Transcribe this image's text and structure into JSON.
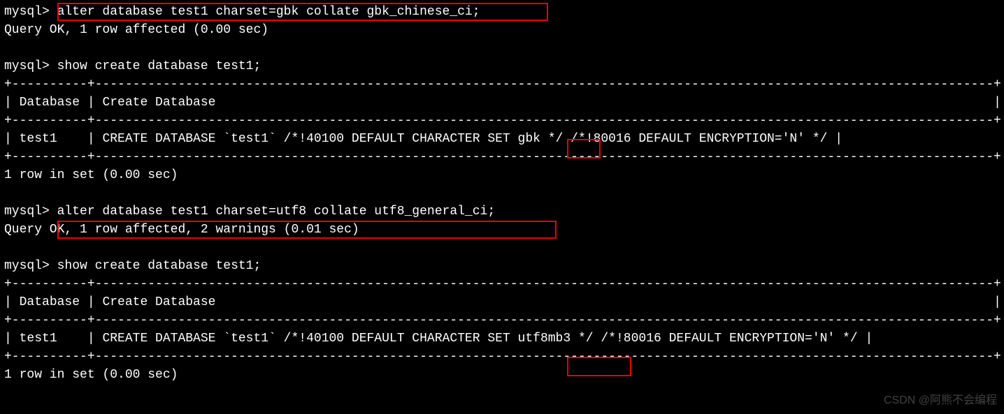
{
  "prompt": "mysql>",
  "cmd1": "alter database test1 charset=gbk collate gbk_chinese_ci;",
  "resp1": "Query OK, 1 row affected (0.00 sec)",
  "cmd2": "show create database test1;",
  "sep_full": "+----------+-----------------------------------------------------------------------------------------------------------------------+",
  "hdr_db": "Database",
  "hdr_create": "Create Database",
  "row1_db": "test1",
  "row1_pre": "CREATE DATABASE `test1` /*!40100 DEFAULT CHARACTER SET ",
  "row1_charset": "gbk",
  "row1_post": " */ /*!80016 DEFAULT ENCRYPTION='N' */ |",
  "footer1": "1 row in set (0.00 sec)",
  "cmd3": "alter database test1 charset=utf8 collate utf8_general_ci;",
  "resp3": "Query OK, 1 row affected, 2 warnings (0.01 sec)",
  "cmd4": "show create database test1;",
  "row2_db": "test1",
  "row2_pre": "CREATE DATABASE `test1` /*!40100 DEFAULT CHARACTER SET ",
  "row2_charset": "utf8mb3",
  "row2_post": " */ /*!80016 DEFAULT ENCRYPTION='N' */ |",
  "footer2": "1 row in set (0.00 sec)",
  "hdr_row_end": "|",
  "watermark": "CSDN @阿熊不会编程"
}
